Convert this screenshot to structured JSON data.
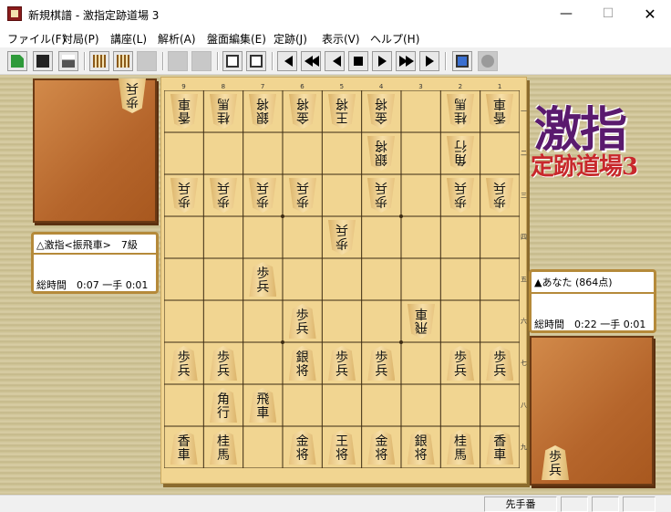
{
  "window": {
    "title": "新規棋譜 - 激指定跡道場 3",
    "minimize_glyph": "—",
    "maximize_glyph": "☐",
    "close_glyph": "✕"
  },
  "menu": [
    "ファイル(F)",
    "対局(P)",
    "講座(L)",
    "解析(A)",
    "盤面編集(E)",
    "定跡(J)",
    "表示(V)",
    "ヘルプ(H)"
  ],
  "toolbar": {
    "icons": [
      "new-file-icon",
      "save-icon",
      "print-icon",
      "kifu-icon",
      "kifu-view-icon",
      "disabled-icon",
      "board-icon",
      "board2-icon",
      "edit-icon",
      "edit2-icon",
      "first-icon",
      "back10-icon",
      "back-icon",
      "stop-icon",
      "forward-icon",
      "forward10-icon",
      "last-icon",
      "monitor-icon",
      "help-icon"
    ]
  },
  "board": {
    "file_numbers": [
      "9",
      "8",
      "7",
      "6",
      "5",
      "4",
      "3",
      "2",
      "1"
    ],
    "rank_numbers": [
      "一",
      "二",
      "三",
      "四",
      "五",
      "六",
      "七",
      "八",
      "九"
    ]
  },
  "pieces": [
    {
      "file": 9,
      "rank": 1,
      "label": "香車",
      "owner": "gote"
    },
    {
      "file": 8,
      "rank": 1,
      "label": "桂馬",
      "owner": "gote"
    },
    {
      "file": 7,
      "rank": 1,
      "label": "銀将",
      "owner": "gote"
    },
    {
      "file": 6,
      "rank": 1,
      "label": "金将",
      "owner": "gote"
    },
    {
      "file": 5,
      "rank": 1,
      "label": "王将",
      "owner": "gote"
    },
    {
      "file": 4,
      "rank": 1,
      "label": "金将",
      "owner": "gote"
    },
    {
      "file": 2,
      "rank": 1,
      "label": "桂馬",
      "owner": "gote"
    },
    {
      "file": 1,
      "rank": 1,
      "label": "香車",
      "owner": "gote"
    },
    {
      "file": 4,
      "rank": 2,
      "label": "銀将",
      "owner": "gote"
    },
    {
      "file": 2,
      "rank": 2,
      "label": "角行",
      "owner": "gote"
    },
    {
      "file": 9,
      "rank": 3,
      "label": "歩兵",
      "owner": "gote"
    },
    {
      "file": 8,
      "rank": 3,
      "label": "歩兵",
      "owner": "gote"
    },
    {
      "file": 7,
      "rank": 3,
      "label": "歩兵",
      "owner": "gote"
    },
    {
      "file": 6,
      "rank": 3,
      "label": "歩兵",
      "owner": "gote"
    },
    {
      "file": 4,
      "rank": 3,
      "label": "歩兵",
      "owner": "gote"
    },
    {
      "file": 2,
      "rank": 3,
      "label": "歩兵",
      "owner": "gote"
    },
    {
      "file": 1,
      "rank": 3,
      "label": "歩兵",
      "owner": "gote"
    },
    {
      "file": 5,
      "rank": 4,
      "label": "歩兵",
      "owner": "gote"
    },
    {
      "file": 3,
      "rank": 6,
      "label": "飛車",
      "owner": "gote"
    },
    {
      "file": 7,
      "rank": 5,
      "label": "歩兵",
      "owner": "sente"
    },
    {
      "file": 6,
      "rank": 6,
      "label": "歩兵",
      "owner": "sente"
    },
    {
      "file": 9,
      "rank": 7,
      "label": "歩兵",
      "owner": "sente"
    },
    {
      "file": 8,
      "rank": 7,
      "label": "歩兵",
      "owner": "sente"
    },
    {
      "file": 6,
      "rank": 7,
      "label": "銀将",
      "owner": "sente"
    },
    {
      "file": 5,
      "rank": 7,
      "label": "歩兵",
      "owner": "sente"
    },
    {
      "file": 4,
      "rank": 7,
      "label": "歩兵",
      "owner": "sente"
    },
    {
      "file": 2,
      "rank": 7,
      "label": "歩兵",
      "owner": "sente"
    },
    {
      "file": 1,
      "rank": 7,
      "label": "歩兵",
      "owner": "sente"
    },
    {
      "file": 8,
      "rank": 8,
      "label": "角行",
      "owner": "sente"
    },
    {
      "file": 7,
      "rank": 8,
      "label": "飛車",
      "owner": "sente"
    },
    {
      "file": 9,
      "rank": 9,
      "label": "香車",
      "owner": "sente"
    },
    {
      "file": 8,
      "rank": 9,
      "label": "桂馬",
      "owner": "sente"
    },
    {
      "file": 6,
      "rank": 9,
      "label": "金将",
      "owner": "sente"
    },
    {
      "file": 5,
      "rank": 9,
      "label": "王将",
      "owner": "sente"
    },
    {
      "file": 4,
      "rank": 9,
      "label": "金将",
      "owner": "sente"
    },
    {
      "file": 3,
      "rank": 9,
      "label": "銀将",
      "owner": "sente"
    },
    {
      "file": 2,
      "rank": 9,
      "label": "桂馬",
      "owner": "sente"
    },
    {
      "file": 1,
      "rank": 9,
      "label": "香車",
      "owner": "sente"
    }
  ],
  "gote_hand": [
    {
      "label": "歩兵"
    }
  ],
  "sente_hand": [
    {
      "label": "歩兵"
    }
  ],
  "gote_player": {
    "name": "△激指<振飛車>　7級",
    "time": "総時間　0:07 一手 0:01"
  },
  "sente_player": {
    "name": "▲あなた (864点)",
    "time": "総時間　0:22 一手 0:01"
  },
  "logo": {
    "main": "激指",
    "sub": "定跡道場3"
  },
  "status": {
    "turn": "先手番"
  }
}
